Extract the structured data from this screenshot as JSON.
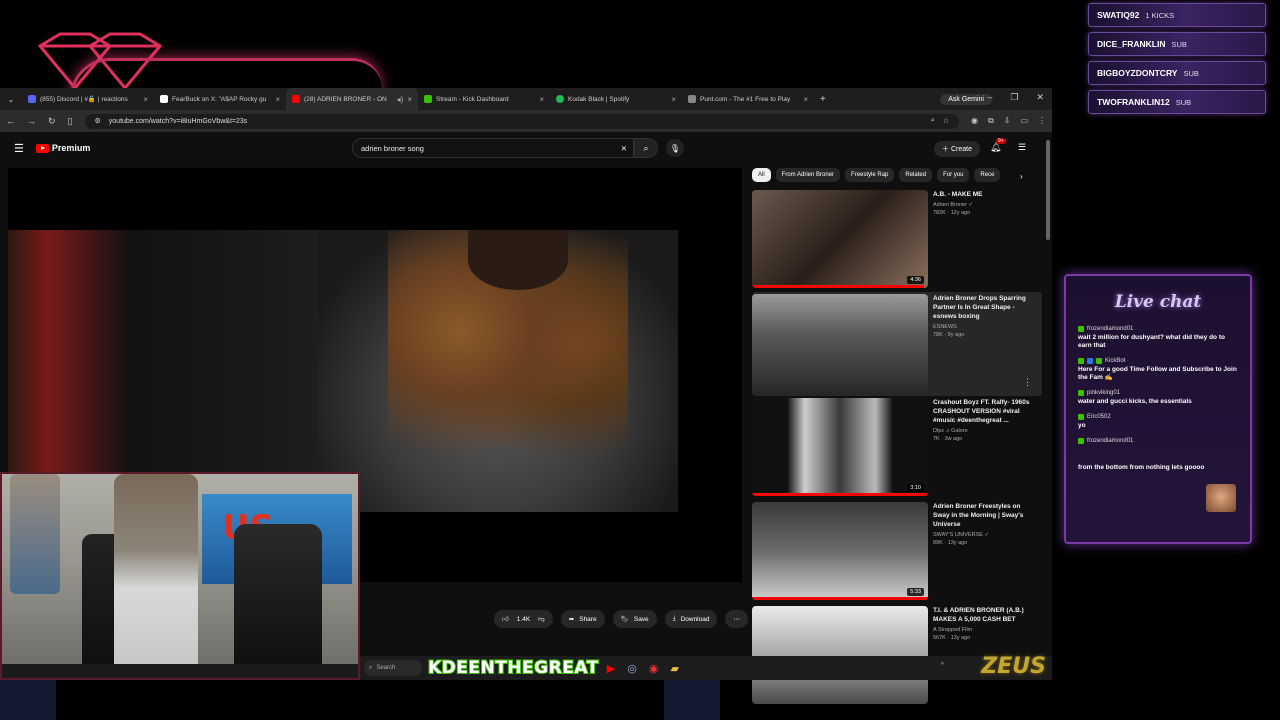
{
  "alerts": [
    {
      "name": "SWATIQ92",
      "kind": "1 KICKS"
    },
    {
      "name": "DICE_FRANKLIN",
      "kind": "SUB"
    },
    {
      "name": "BIGBOYZDONTCRY",
      "kind": "SUB"
    },
    {
      "name": "TWOFRANKLIN12",
      "kind": "SUB"
    }
  ],
  "browser": {
    "tabs": [
      {
        "title": "(855) Discord | #🔒 | reactions",
        "color": "#5865f2",
        "active": false
      },
      {
        "title": "FearBuck on X: \"A$AP Rocky gu",
        "color": "#ffffff",
        "active": false
      },
      {
        "title": "(28) ADRIEN BRONER - ON",
        "color": "#ff0000",
        "active": true
      },
      {
        "title": "Stream - Kick Dashboard",
        "color": "#39c200",
        "active": false
      },
      {
        "title": "Kodak Black | Spotify",
        "color": "#1db954",
        "active": false
      },
      {
        "title": "Punt.com - The #1 Free to Play",
        "color": "#888888",
        "active": false
      }
    ],
    "new_tab": "+",
    "ask_gemini": "Ask Gemini",
    "url": "youtube.com/watch?v=i8iuHmGoVbw&t=23s"
  },
  "youtube": {
    "logo": "Premium",
    "search_query": "adrien broner song",
    "create_label": "Create",
    "bell_badge": "9+",
    "chips": [
      "All",
      "From Adrien Broner",
      "Freestyle Rap",
      "Related",
      "For you",
      "Rece"
    ],
    "actions": {
      "likes": "1.4K",
      "share": "Share",
      "save": "Save",
      "download": "Download"
    },
    "recommendations": [
      {
        "title": "A.B. - MAKE ME",
        "channel": "Adrien Broner ✓",
        "stats": "782K · 12y ago",
        "duration": "4:36",
        "progress": 0.98,
        "hover": false
      },
      {
        "title": "Adrien Broner Drops Sparring Partner Is In Great Shape - esnews boxing",
        "channel": "ESNEWS",
        "stats": "78K · 9y ago",
        "duration": "",
        "progress": 0,
        "hover": true
      },
      {
        "title": "Crashout Boyz FT. Ralfy- 1960s CRASHOUT VERSION #viral #music #deenthegreat ...",
        "channel": "Dlpz ♫ Galore",
        "stats": "7K · 3w ago",
        "duration": "3:10",
        "progress": 1.0,
        "hover": false
      },
      {
        "title": "Adrien Broner Freestyles on Sway in the Morning | Sway's Universe",
        "channel": "SWAY'S UNIVERSE ✓",
        "stats": "89K · 13y ago",
        "duration": "5:33",
        "progress": 1.0,
        "hover": false
      },
      {
        "title": "T.I. & ADRIEN BRONER (A.B.) MAKES A 5,000 CASH BET",
        "channel": "A Strapped Film",
        "stats": "567K · 13y ago",
        "duration": "",
        "progress": 0,
        "hover": false
      }
    ]
  },
  "taskbar": {
    "search_placeholder": "Search",
    "kick_name": "KDEENTHEGREAT",
    "zeus": "ZEUS"
  },
  "chat": {
    "title": "Live chat",
    "messages": [
      {
        "user": "frozendiamond01",
        "text": "wait 2 million for dushyant? what did they do to earn that",
        "badge": "kick"
      },
      {
        "user": "KickBot",
        "text": "Here For a good Time Follow and Subscribe to Join the Fam ✍",
        "badge": "bot"
      },
      {
        "user": "pinkviking01",
        "text": "water and gucci kicks, the essentials",
        "badge": "kick"
      },
      {
        "user": "Eric0502",
        "text": "yo",
        "badge": "kick"
      },
      {
        "user": "frozendiamond01",
        "text": "",
        "badge": "kick"
      },
      {
        "user": "",
        "text": "from the bottom from nothing lets goooo",
        "badge": "none"
      }
    ]
  },
  "colors": {
    "accent": "#ff0000",
    "kick_green": "#39c200",
    "neon_purple": "#7a3aa8"
  }
}
